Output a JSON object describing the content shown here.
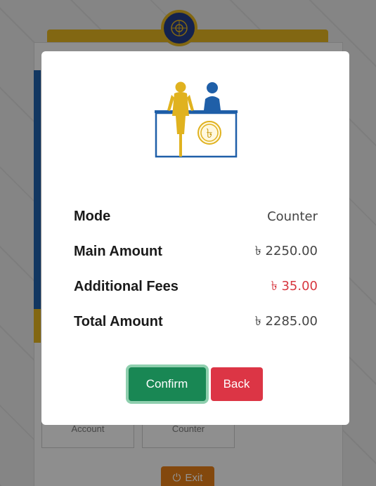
{
  "background": {
    "tiles": [
      {
        "label": "Account"
      },
      {
        "label": "Counter"
      }
    ],
    "exit_label": "Exit"
  },
  "modal": {
    "illustration": "counter-payment-illustration",
    "rows": [
      {
        "label": "Mode",
        "value": "Counter"
      },
      {
        "label": "Main Amount",
        "value": "৳ 2250.00"
      },
      {
        "label": "Additional Fees",
        "value": "৳ 35.00"
      },
      {
        "label": "Total Amount",
        "value": "৳ 2285.00"
      }
    ],
    "confirm_label": "Confirm",
    "back_label": "Back"
  },
  "colors": {
    "confirm": "#198754",
    "back": "#dc3545",
    "fee_text": "#d7373f",
    "brand_yellow": "#e0b21f",
    "brand_blue": "#1f5fa8"
  }
}
